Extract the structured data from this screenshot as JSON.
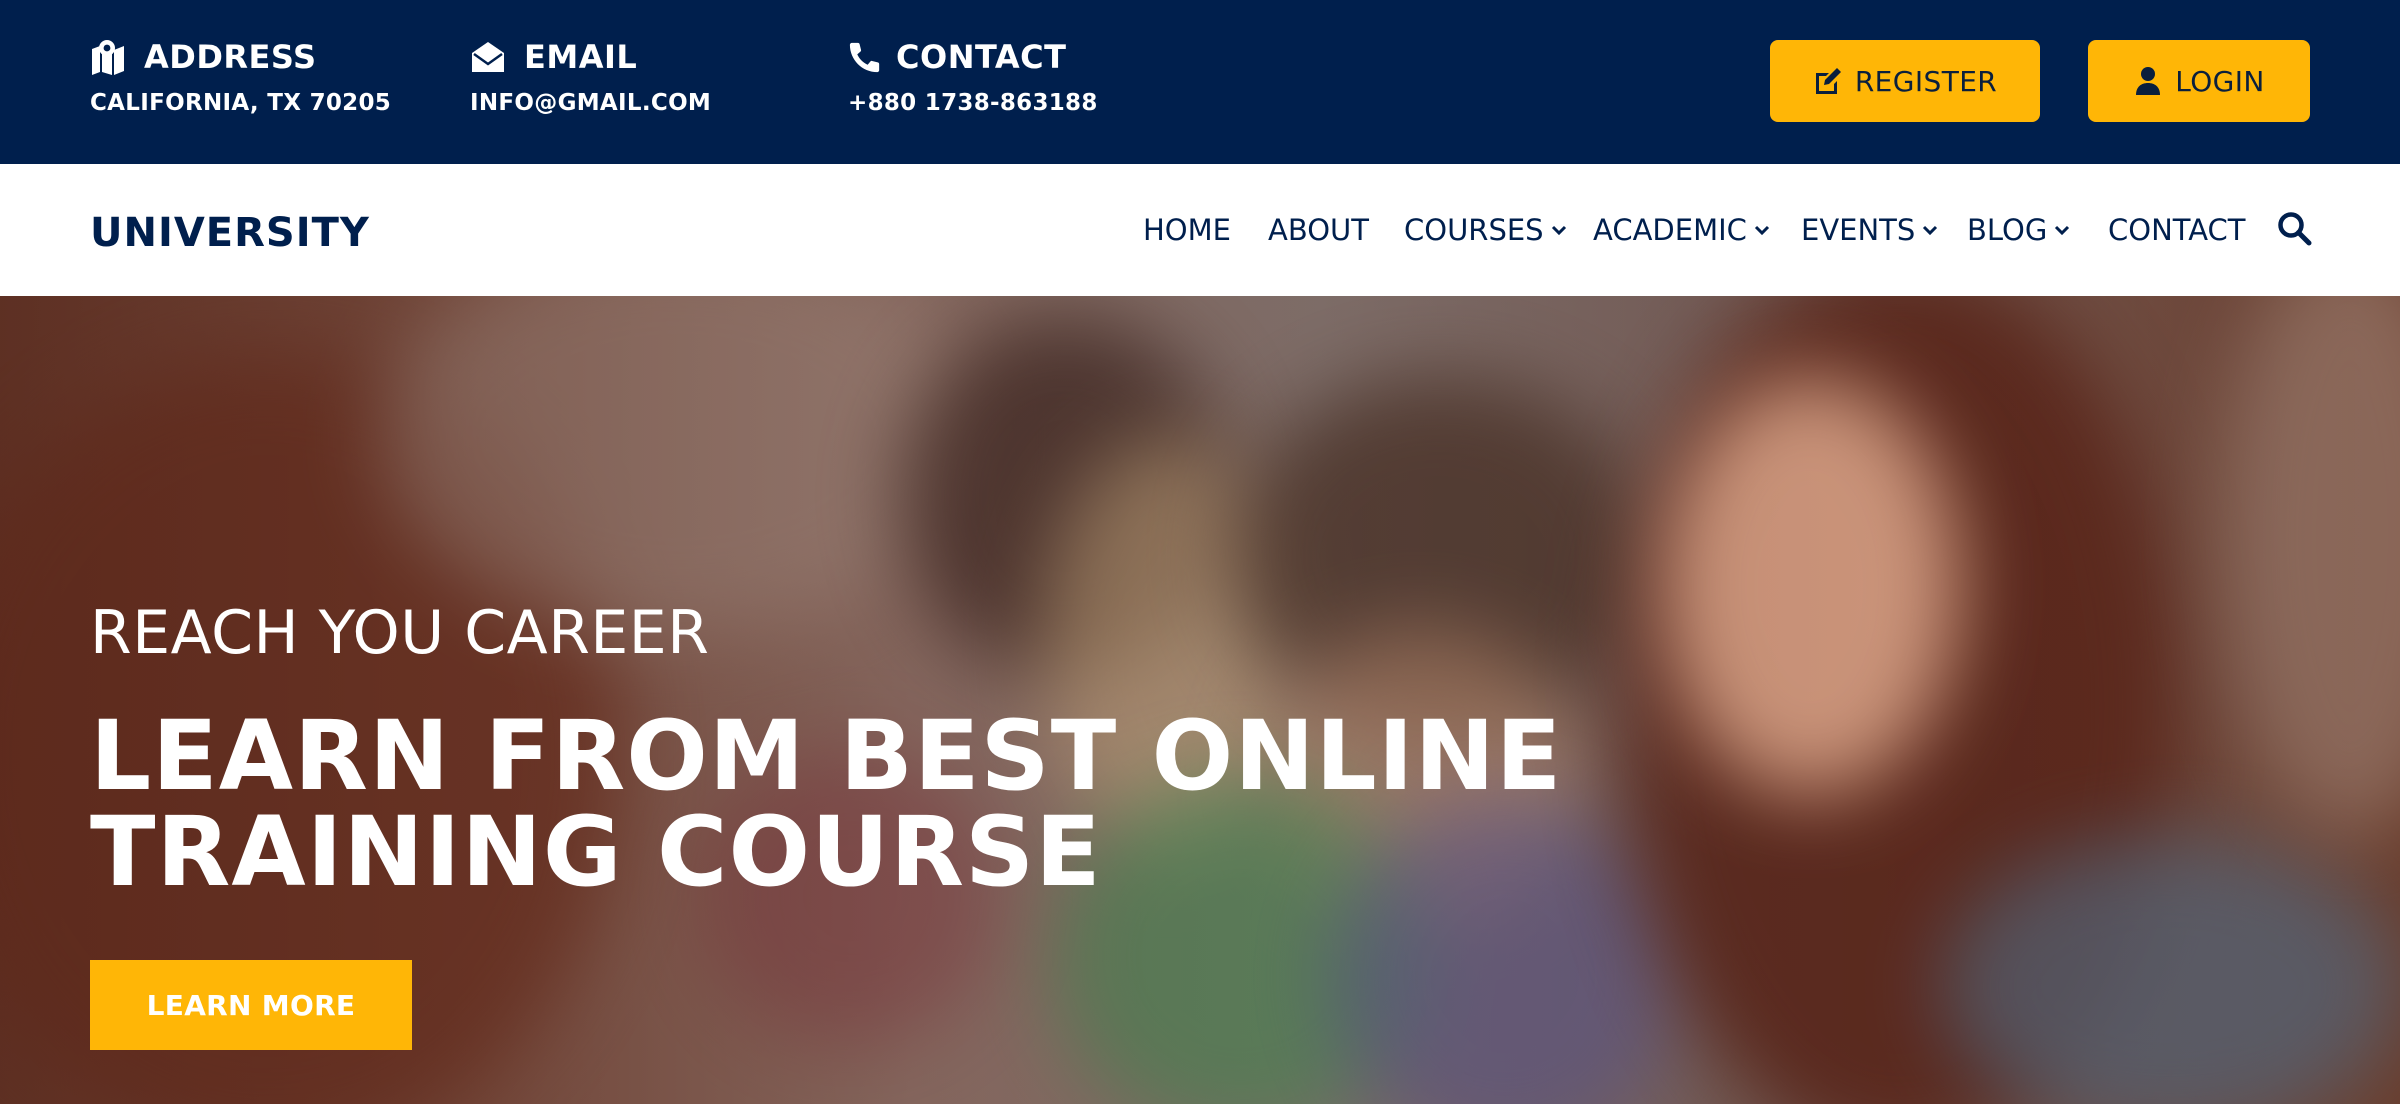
{
  "topbar": {
    "address": {
      "title": "ADDRESS",
      "value": "CALIFORNIA, TX 70205",
      "icon": "map-marker-icon"
    },
    "email": {
      "title": "EMAIL",
      "value": "INFO@GMAIL.COM",
      "icon": "envelope-open-icon"
    },
    "contact": {
      "title": "CONTACT",
      "value": "+880 1738-863188",
      "icon": "phone-icon"
    },
    "register_label": "REGISTER",
    "login_label": "LOGIN"
  },
  "nav": {
    "logo": "UNIVERSITY",
    "items": [
      {
        "label": "HOME",
        "dropdown": false
      },
      {
        "label": "ABOUT",
        "dropdown": false
      },
      {
        "label": "COURSES",
        "dropdown": true
      },
      {
        "label": "ACADEMIC",
        "dropdown": true
      },
      {
        "label": "EVENTS",
        "dropdown": true
      },
      {
        "label": "BLOG",
        "dropdown": true
      },
      {
        "label": "CONTACT",
        "dropdown": false
      }
    ]
  },
  "hero": {
    "subtitle": "REACH YOU CAREER",
    "title": "LEARN FROM BEST ONLINE TRAINING COURSE",
    "button_label": "LEARN MORE"
  },
  "colors": {
    "navy": "#001f4d",
    "accent": "#ffb606",
    "white": "#ffffff"
  }
}
